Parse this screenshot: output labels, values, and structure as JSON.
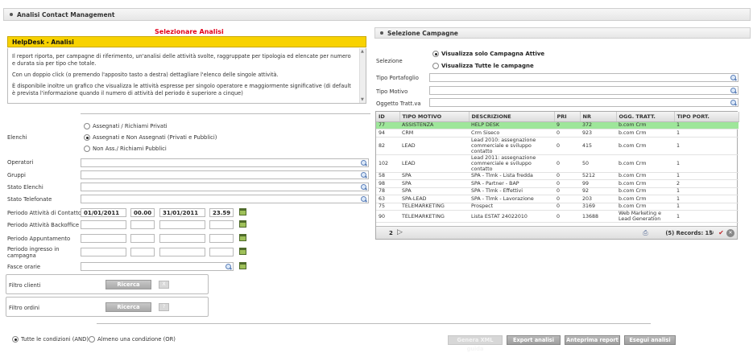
{
  "header": {
    "title": "Analisi Contact Management"
  },
  "left": {
    "select_title": "Selezionare Analisi",
    "selected_analysis": "HelpDesk - Analisi",
    "description": [
      "Il report riporta, per campagne di riferimento, un'analisi delle attività svolte, raggruppate per tipologia ed elencate per numero e durata sia per tipo che totale.",
      "Con un doppio click (o premendo l'apposito tasto a destra) dettagliare l'elenco delle singole attività.",
      "È disponibile inoltre un grafico che visualizza le attività espresse per singolo operatore e maggiormente significative (di default è prevista l'informazione quando il numero di attività del periodo è superiore a cinque)"
    ],
    "elenchi_label": "Elenchi",
    "elenchi_options": [
      {
        "label": "Assegnati / Richiami Privati",
        "selected": false
      },
      {
        "label": "Assegnati e Non Assegnati (Privati e Pubblici)",
        "selected": true
      },
      {
        "label": "Non Ass./ Richiami Pubblici",
        "selected": false
      }
    ],
    "fields": {
      "operatori": "Operatori",
      "gruppi": "Gruppi",
      "stato_elenchi": "Stato Elenchi",
      "stato_telefonate": "Stato Telefonate"
    },
    "periods": {
      "contatto": {
        "label": "Periodo Attività di Contatto",
        "date_from": "01/01/2011",
        "time_from": "00.00",
        "date_to": "31/01/2011",
        "time_to": "23.59"
      },
      "backoffice": {
        "label": "Periodo Attività Backoffice"
      },
      "appuntamento": {
        "label": "Periodo Appuntamento"
      },
      "ingresso": {
        "label_line1": "Periodo ingresso in",
        "label_line2": "campagna"
      }
    },
    "fasce_label": "Fasce orarie",
    "filtro_clienti": {
      "label": "Filtro clienti",
      "button": "Ricerca",
      "clear": "X"
    },
    "filtro_ordini": {
      "label": "Filtro ordini",
      "button": "Ricerca",
      "clear": "?"
    },
    "conditions": [
      {
        "label": "Tutte le condizioni (AND)",
        "selected": true
      },
      {
        "label": "Almeno una condizione (OR)",
        "selected": false
      }
    ]
  },
  "right": {
    "title": "Selezione Campagne",
    "selezione_label": "Selezione",
    "selezione_options": [
      {
        "label": "Visualizza solo Campagna Attive",
        "selected": true
      },
      {
        "label": "Visualizza Tutte le campagne",
        "selected": false
      }
    ],
    "filters": {
      "tipo_portafoglio": "Tipo Portafoglio",
      "tipo_motivo": "Tipo Motivo",
      "oggetto": "Oggetto Tratt.va"
    },
    "grid": {
      "columns": [
        "ID",
        "TIPO MOTIVO",
        "DESCRIZIONE",
        "PRI",
        "NR",
        "OGG. TRATT.",
        "TIPO PORT."
      ],
      "rows": [
        {
          "id": "77",
          "tipo": "ASSISTENZA",
          "desc": "HELP DESK",
          "pri": "9",
          "nr": "372",
          "ogg": "b.com Crm",
          "port": "1",
          "selected": true
        },
        {
          "id": "94",
          "tipo": "CRM",
          "desc": "Crm Siseco",
          "pri": "0",
          "nr": "923",
          "ogg": "b.com Crm",
          "port": "1"
        },
        {
          "id": "82",
          "tipo": "LEAD",
          "desc": "Lead 2010: assegnazione commerciale e sviluppo contatto",
          "pri": "0",
          "nr": "415",
          "ogg": "b.com Crm",
          "port": "1",
          "tall": true
        },
        {
          "id": "102",
          "tipo": "LEAD",
          "desc": "Lead 2011: assegnazione commerciale e sviluppo contatto",
          "pri": "0",
          "nr": "50",
          "ogg": "b.com Crm",
          "port": "1",
          "tall": true
        },
        {
          "id": "58",
          "tipo": "SPA",
          "desc": "SPA - Tlmk - Lista fredda",
          "pri": "0",
          "nr": "5212",
          "ogg": "b.com Crm",
          "port": "1"
        },
        {
          "id": "98",
          "tipo": "SPA",
          "desc": "SPA - Partner - BAP",
          "pri": "0",
          "nr": "99",
          "ogg": "b.com Crm",
          "port": "2"
        },
        {
          "id": "78",
          "tipo": "SPA",
          "desc": "SPA - Tlmk - Effettivi",
          "pri": "0",
          "nr": "92",
          "ogg": "b.com Crm",
          "port": "1"
        },
        {
          "id": "63",
          "tipo": "SPA-LEAD",
          "desc": "SPA - Tlmk - Lavorazione",
          "pri": "0",
          "nr": "203",
          "ogg": "b.com Crm",
          "port": "1"
        },
        {
          "id": "75",
          "tipo": "TELEMARKETING",
          "desc": "Prospect",
          "pri": "0",
          "nr": "3169",
          "ogg": "b.com Crm",
          "port": "1"
        },
        {
          "id": "90",
          "tipo": "TELEMARKETING",
          "desc": "Lista ESTAT 24022010",
          "pri": "0",
          "nr": "13688",
          "ogg": "Web Marketing e Lead Generation",
          "port": "1",
          "tall": true
        }
      ],
      "page": "2",
      "records": "(5) Records: 15"
    }
  },
  "buttons": {
    "genera_xml": "Genera XML guida",
    "export": "Export analisi",
    "anteprima": "Anteprima report",
    "esegui": "Esegui analisi"
  }
}
